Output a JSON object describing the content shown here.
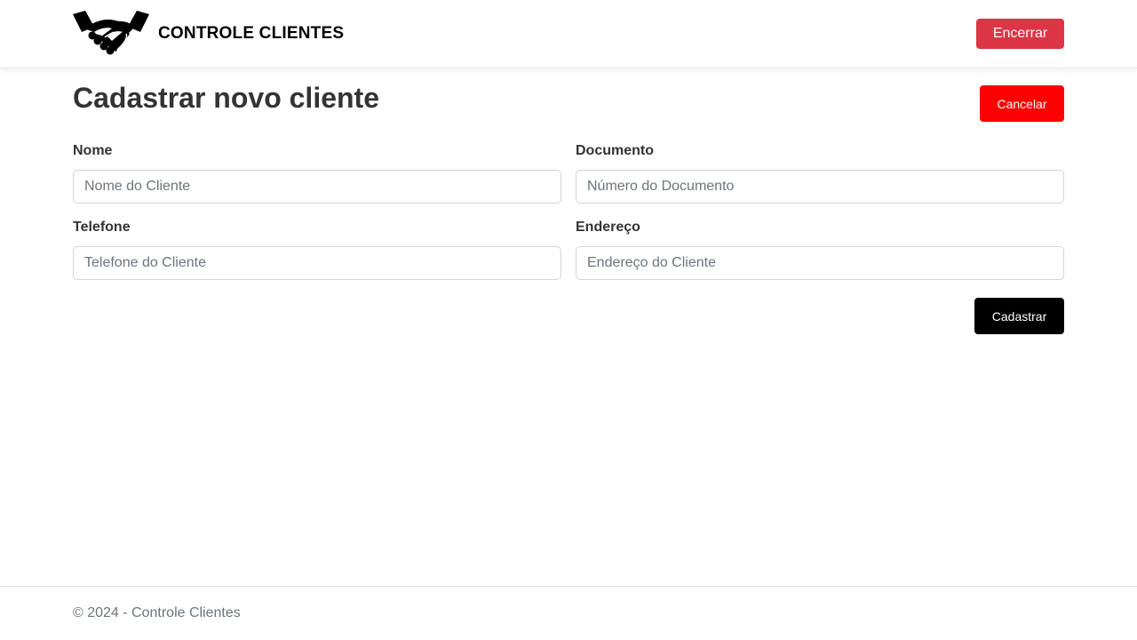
{
  "navbar": {
    "brand_text": "CONTROLE CLIENTES",
    "logo_icon": "handshake-icon",
    "logout_label": "Encerrar"
  },
  "page": {
    "title": "Cadastrar novo cliente",
    "cancel_label": "Cancelar",
    "submit_label": "Cadastrar"
  },
  "form": {
    "nome": {
      "label": "Nome",
      "placeholder": "Nome do Cliente",
      "value": ""
    },
    "documento": {
      "label": "Documento",
      "placeholder": "Número do Documento",
      "value": ""
    },
    "telefone": {
      "label": "Telefone",
      "placeholder": "Telefone do Cliente",
      "value": ""
    },
    "endereco": {
      "label": "Endereço",
      "placeholder": "Endereço do Cliente",
      "value": ""
    }
  },
  "footer": {
    "text": "© 2024 - Controle Clientes"
  },
  "colors": {
    "logout_button": "#dc3545",
    "cancel_button": "#ff0000",
    "submit_button": "#000000",
    "text": "#333333"
  }
}
